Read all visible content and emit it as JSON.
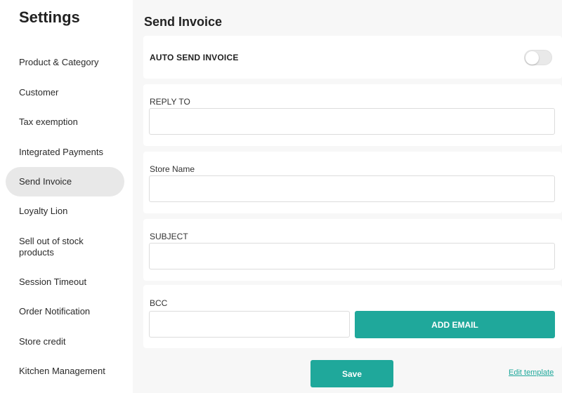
{
  "sidebar": {
    "title": "Settings",
    "items": [
      {
        "label": "Product & Category"
      },
      {
        "label": "Customer"
      },
      {
        "label": "Tax exemption"
      },
      {
        "label": "Integrated Payments"
      },
      {
        "label": "Send Invoice"
      },
      {
        "label": "Loyalty Lion"
      },
      {
        "label": "Sell out of stock products"
      },
      {
        "label": "Session Timeout"
      },
      {
        "label": "Order Notification"
      },
      {
        "label": "Store credit"
      },
      {
        "label": "Kitchen Management"
      }
    ],
    "active_item": "Send Invoice"
  },
  "main": {
    "title": "Send Invoice",
    "auto_send": {
      "label": "AUTO SEND INVOICE",
      "enabled": false
    },
    "reply_to": {
      "label": "REPLY TO",
      "value": ""
    },
    "store_name": {
      "label": "Store Name",
      "value": ""
    },
    "subject": {
      "label": "SUBJECT",
      "value": ""
    },
    "bcc": {
      "label": "BCC",
      "value": "",
      "add_button": "ADD EMAIL"
    },
    "save_label": "Save",
    "edit_template_label": "Edit template"
  },
  "colors": {
    "accent": "#1fa89b",
    "active_nav_bg": "#e8e8e8",
    "page_bg": "#f7f7f7"
  }
}
